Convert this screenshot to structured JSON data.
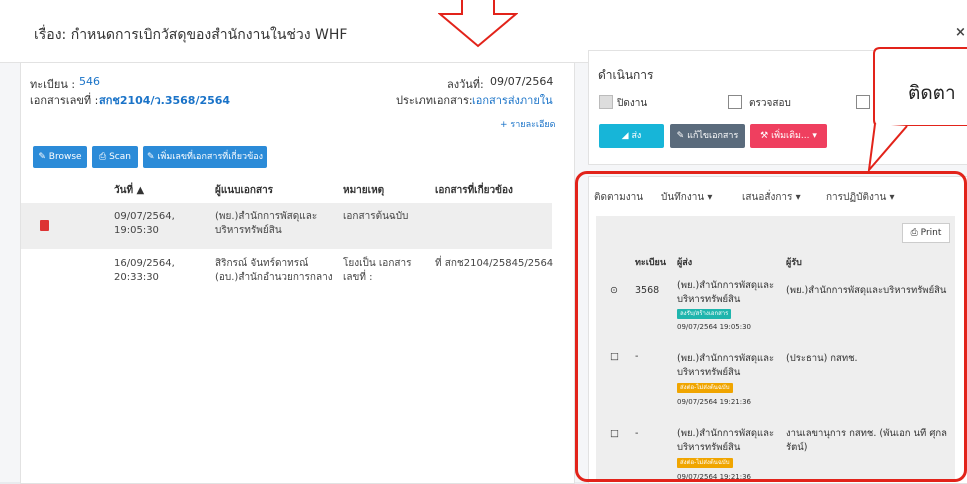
{
  "dialog": {
    "title": "เรื่อง: กำหนดการเบิกวัสดุของสำนักงานในช่วง WHF",
    "close_label": "×"
  },
  "document": {
    "reg_label": "ทะเบียน :",
    "reg_value": "546",
    "docno_label": "เอกสารเลขที่ :",
    "docno_value": "สกช2104/ว.3568/2564",
    "date_label": "ลงวันที่:",
    "date_value": "09/07/2564",
    "type_label": "ประเภทเอกสาร:",
    "type_value": "เอกสารส่งภายใน",
    "details_link": "+ รายละเอียด"
  },
  "attach_buttons": {
    "browse": "✎ Browse",
    "scan": "⎙ Scan",
    "link_related": "✎ เพิ่มเลขที่เอกสารที่เกี่ยวข้อง"
  },
  "attach_table": {
    "headers": {
      "date": "วันที่ ▲",
      "attacher": "ผู้แนบเอกสาร",
      "note": "หมายเหตุ",
      "related": "เอกสารที่เกี่ยวข้อง"
    },
    "rows": [
      {
        "date": "09/07/2564, 19:05:30",
        "attacher": "(พย.)สำนักการพัสดุและบริหารทรัพย์สิน",
        "note": "เอกสารต้นฉบับ",
        "related": ""
      },
      {
        "date": "16/09/2564, 20:33:30",
        "attacher": "สิริกรณ์ จันทร์ดาทรณ์ (อบ.)สำนักอำนวยการกลาง",
        "note": "โยงเป็น เอกสารเลขที่ :",
        "related": "ที่ สกช2104/25845/2564"
      }
    ]
  },
  "actions": {
    "title": "ดำเนินการ",
    "checkboxes": {
      "close": "ปิดงาน",
      "review": "ตรวจสอบ"
    },
    "buttons": {
      "send": "◢ ส่ง",
      "edit": "✎ แก้ไขเอกสาร",
      "more": "⚒ เพิ่มเติม... ▾"
    }
  },
  "callout": {
    "text": "ติดตา"
  },
  "tabs": {
    "track": "ติดตามงาน",
    "record": "บันทึกงาน ▾",
    "propose": "เสนอสั่งการ ▾",
    "operations": "การปฏิบัติงาน ▾"
  },
  "tracking": {
    "print": "⎙ Print",
    "headers": {
      "reg": "ทะเบียน",
      "sender": "ผู้ส่ง",
      "receiver": "ผู้รับ"
    },
    "rows": [
      {
        "icon": "⊙",
        "reg": "3568",
        "sender": "(พย.)สำนักการพัสดุและบริหารทรัพย์สิน",
        "badge": "ลงรับ/สร้างเอกสาร",
        "badge_color": "#1fb5ad",
        "time": "09/07/2564 19:05:30",
        "receiver": "(พย.)สำนักการพัสดุและบริหารทรัพย์สิน"
      },
      {
        "icon": "□",
        "reg": "-",
        "sender": "(พย.)สำนักการพัสดุและบริหารทรัพย์สิน",
        "badge": "ส่งต่อ-ไม่ส่งต้นฉบับ",
        "badge_color": "#f0a500",
        "time": "09/07/2564 19:21:36",
        "receiver": "(ประธาน) กสทช."
      },
      {
        "icon": "□",
        "reg": "-",
        "sender": "(พย.)สำนักการพัสดุและบริหารทรัพย์สิน",
        "badge": "ส่งต่อ-ไม่ส่งต้นฉบับ",
        "badge_color": "#f0a500",
        "time": "09/07/2564 19:21:36",
        "receiver": "งานเลขานุการ กสทช. (พันเอก นที ศุกลรัตน์)"
      }
    ]
  },
  "colors": {
    "accent_blue": "#2b8bd8",
    "send_cyan": "#17b5d8",
    "edit_slate": "#5a6b7c",
    "more_pink": "#ef3f5f",
    "highlight_red": "#e2231a"
  }
}
